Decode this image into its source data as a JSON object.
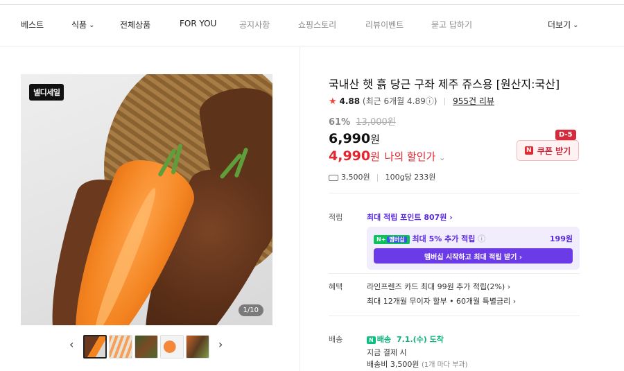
{
  "nav": {
    "items": [
      {
        "label": "베스트",
        "has_dropdown": false,
        "style": "dark"
      },
      {
        "label": "식품",
        "has_dropdown": true,
        "style": "dark"
      },
      {
        "label": "전체상품",
        "has_dropdown": false,
        "style": "dark"
      },
      {
        "label": "FOR YOU",
        "has_dropdown": false,
        "style": "dark"
      },
      {
        "label": "공지사항",
        "has_dropdown": false,
        "style": "light"
      },
      {
        "label": "쇼핑스토리",
        "has_dropdown": false,
        "style": "light"
      },
      {
        "label": "리뷰이벤트",
        "has_dropdown": false,
        "style": "light"
      },
      {
        "label": "묻고 답하기",
        "has_dropdown": false,
        "style": "light"
      }
    ],
    "more_label": "더보기"
  },
  "gallery": {
    "brand_logo_text": "넬디세일",
    "counter": "1/10",
    "prev_icon": "chevron-left-icon",
    "next_icon": "chevron-right-icon",
    "thumbnail_count": 5
  },
  "product": {
    "title": "국내산 햇 흙 당근 구좌 제주 쥬스용 [원산지:국산]",
    "rating": "4.88",
    "rating_recent": "(최근 6개월 4.89",
    "rating_recent_end": ")",
    "review_count": "955건 리뷰",
    "discount_rate": "61%",
    "original_price": "13,000원",
    "price": "6,990",
    "price_unit": "원",
    "my_price": "4,990",
    "my_price_unit": "원",
    "my_price_label": "나의 할인가",
    "coupon_label": "쿠폰 받기",
    "coupon_dday": "D-5",
    "shipping_fee": "3,500원",
    "unit_price": "100g당 233원"
  },
  "points": {
    "label": "적립",
    "max_points": "최대 적립 포인트 807원 ›",
    "membership_badge": "N+",
    "membership_badge_sub": "멤버십",
    "membership_extra": "최대 5% 추가 적립",
    "membership_amount": "199원",
    "membership_button": "멤버십 시작하고 최대 적립 받기 ›"
  },
  "benefits": {
    "label": "혜택",
    "line1": "라인프렌즈 카드 최대 99원 추가 적립(2%) ›",
    "line2": "최대 12개월 무이자 할부 • 60개월 특별금리 ›"
  },
  "delivery": {
    "label": "배송",
    "badge": "N",
    "badge_text": "배송",
    "date": "7.1.(수) 도착",
    "line1": "지금 결제 시",
    "fee": "배송비 3,500원",
    "fee_note": "(1개 마다 부과)"
  },
  "colors": {
    "accent_red": "#e5262f",
    "accent_purple": "#5a2ae0",
    "accent_green": "#0bb07a"
  }
}
